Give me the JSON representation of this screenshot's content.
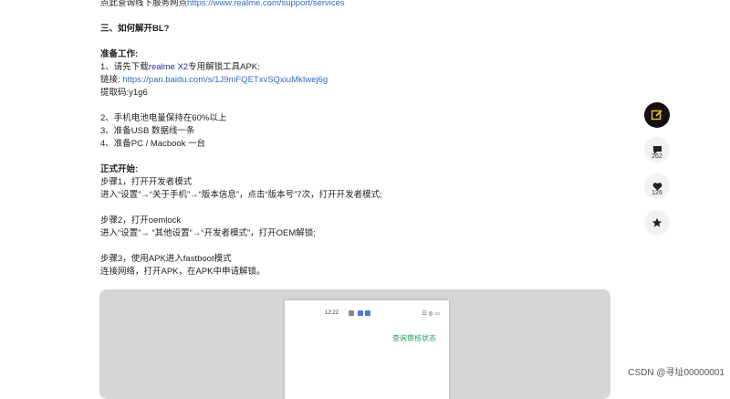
{
  "article": {
    "line_top": "点此查询线下服务网点",
    "line_top_link": "https://www.realme.com/support/services",
    "section_title": "三、如何解开BL?",
    "prep_title": "准备工作:",
    "prep_1_prefix": "1、请先下载",
    "prep_1_link": "realme X2",
    "prep_1_suffix": "专用解锁工具APK:",
    "download_label": "链接:",
    "download_url": "https://pan.baidu.com/s/1J9mFQETxvSQxiuMkIwej6g",
    "code_line": "提取码:y1g6",
    "prep_2": "2、手机电池电量保持在60%以上",
    "prep_3": "3、准备USB 数据线一条",
    "prep_4": "4、准备PC / Macbook 一台",
    "start_title": "正式开始:",
    "step1_title": "步骤1，打开开发者模式",
    "step1_desc": "进入“设置”→“关于手机”→“版本信息”，点击“版本号”7次，打开开发者模式;",
    "step2_title": "步骤2，打开oemlock",
    "step2_desc": "进入“设置”→ “其他设置”→“开发者模式”，打开OEM解锁;",
    "step3_title": "步骤3，使用APK进入fastboot模式",
    "step3_desc": "连接网络，打开APK，在APK中申请解锁。"
  },
  "phone": {
    "time": "12:22",
    "status_right": "☷ ◎ ▭",
    "review_link": "查询审核状态"
  },
  "sidebar": {
    "comments_count": "262",
    "likes_count": "126"
  },
  "watermark": "CSDN @寻址00000001",
  "colors": {
    "link": "#2f6bc6",
    "primary_button": "#111111",
    "phone_link": "#2a9d66"
  }
}
